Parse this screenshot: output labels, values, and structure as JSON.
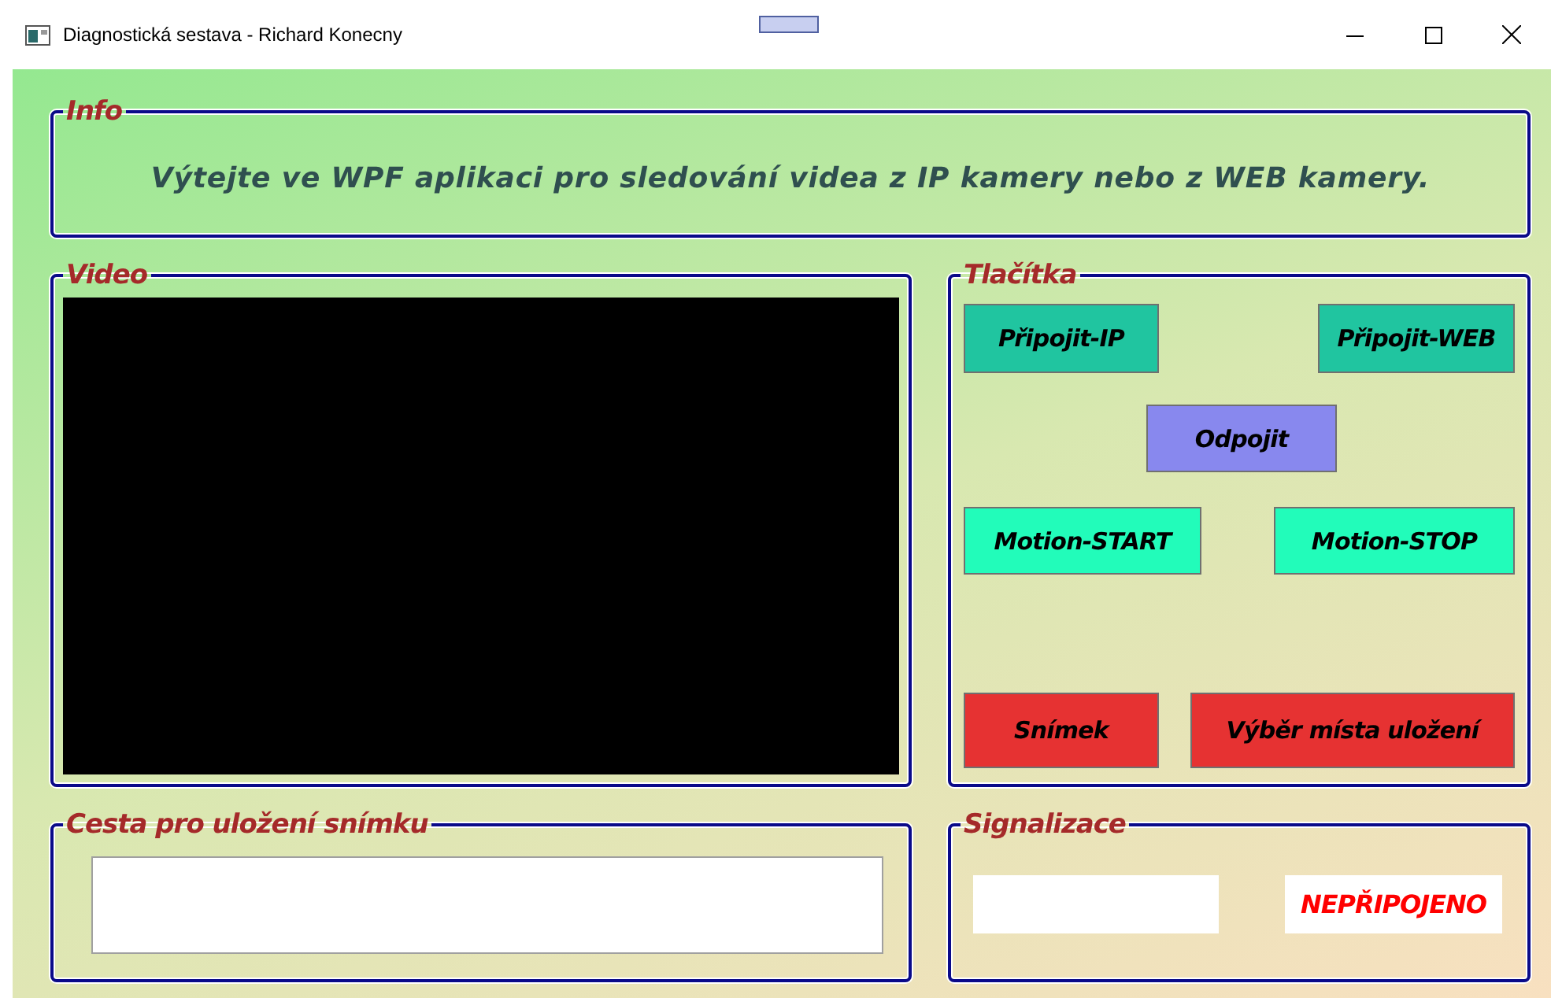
{
  "window": {
    "title": "Diagnostická sestava - Richard Konecny"
  },
  "info": {
    "legend": "Info",
    "text": "Výtejte ve WPF aplikaci pro sledování videa z IP kamery nebo z WEB kamery."
  },
  "video": {
    "legend": "Video"
  },
  "buttons": {
    "legend": "Tlačítka",
    "items": [
      {
        "label": "Připojit-IP",
        "color": "#20c5a0"
      },
      {
        "label": "Připojit-WEB",
        "color": "#20c5a0"
      },
      {
        "label": "Odpojit",
        "color": "#8888ee"
      },
      {
        "label": "Motion-START",
        "color": "#22fcba"
      },
      {
        "label": "Motion-STOP",
        "color": "#22fcba"
      },
      {
        "label": "Snímek",
        "color": "#e63232"
      },
      {
        "label": "Výběr místa uložení",
        "color": "#e63232"
      }
    ]
  },
  "save_path": {
    "legend": "Cesta pro uložení snímku"
  },
  "signal": {
    "legend": "Signalizace",
    "status": "NEPŘIPOJENO"
  }
}
